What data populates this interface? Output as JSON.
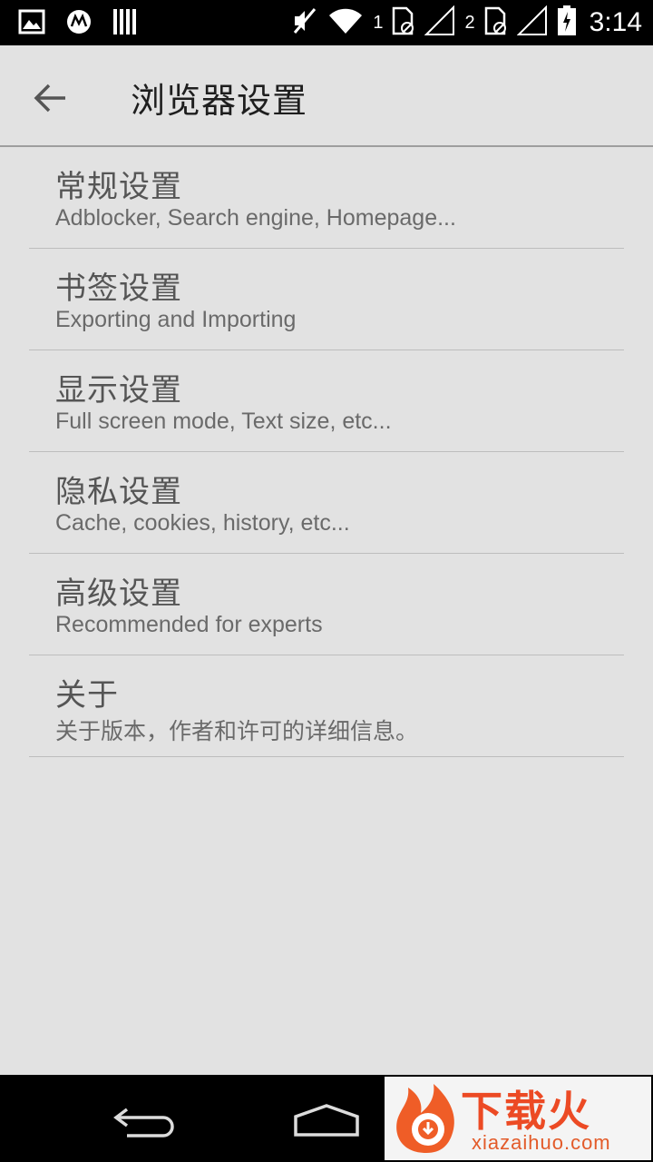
{
  "status_bar": {
    "time": "3:14",
    "sim1": "1",
    "sim2": "2",
    "icons": [
      "image-icon",
      "motorola-icon",
      "barcode-icon",
      "mute-icon",
      "wifi-icon",
      "sim1-icon",
      "signal-1-icon",
      "sim2-icon",
      "signal-2-icon",
      "battery-icon"
    ]
  },
  "header": {
    "title": "浏览器设置",
    "back_icon": "back-arrow-icon"
  },
  "settings": [
    {
      "title": "常规设置",
      "subtitle": "Adblocker, Search engine, Homepage..."
    },
    {
      "title": "书签设置",
      "subtitle": "Exporting and Importing"
    },
    {
      "title": "显示设置",
      "subtitle": "Full screen mode, Text size, etc..."
    },
    {
      "title": "隐私设置",
      "subtitle": "Cache, cookies, history, etc..."
    },
    {
      "title": "高级设置",
      "subtitle": "Recommended for experts"
    },
    {
      "title": "关于",
      "subtitle": "关于版本，作者和许可的详细信息。"
    }
  ],
  "nav_bar": {
    "icons": [
      "nav-back-icon",
      "nav-home-icon"
    ]
  },
  "watermark": {
    "brand": "下载火",
    "url": "xiazaihuo.com"
  },
  "colors": {
    "background": "#e2e2e2",
    "divider": "#bdbdbd",
    "title_text": "#1e1e1e",
    "item_text": "#555555",
    "status_bar": "#000000",
    "watermark": "#ec4a24"
  }
}
